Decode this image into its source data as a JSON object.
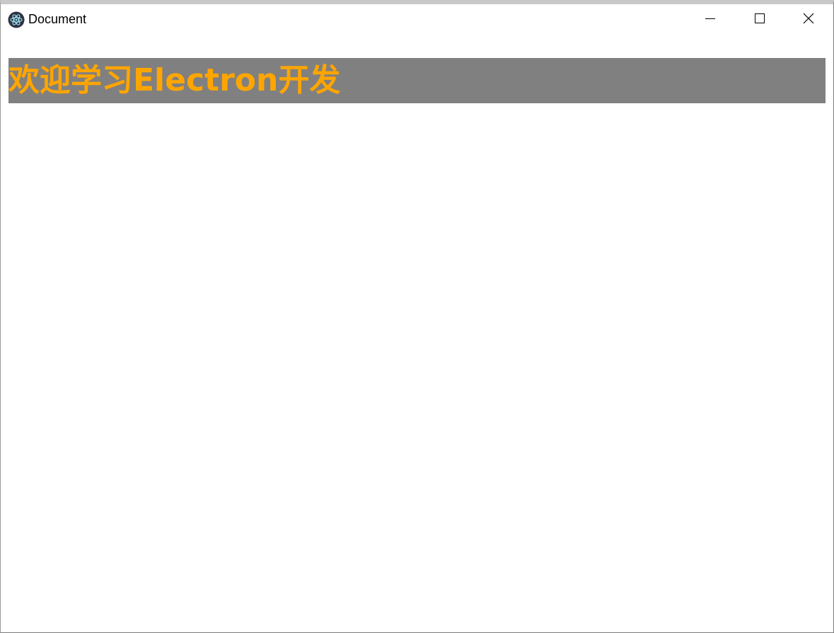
{
  "window": {
    "title": "Document",
    "app_icon": "electron-logo-icon",
    "controls": {
      "minimize_icon": "minimize-icon",
      "maximize_icon": "maximize-icon",
      "close_icon": "close-icon"
    }
  },
  "main": {
    "heading": "欢迎学习Electron开发"
  },
  "colors": {
    "heading_text": "#ffa500",
    "heading_background": "#808080"
  }
}
